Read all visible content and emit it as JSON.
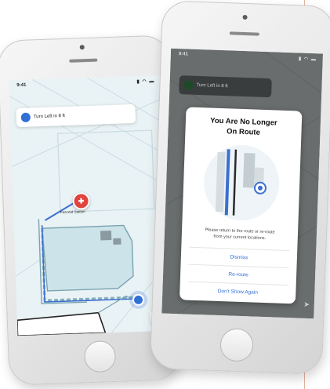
{
  "left_phone": {
    "status": {
      "time": "9:41",
      "icons": "▮ ◠ ▬"
    },
    "nav_card": {
      "text": "Turn Left in 8 ft"
    },
    "poi": {
      "icon": "first-aid-icon",
      "glyph": "✚",
      "label": "First Aid Station"
    },
    "compass_glyph": "➤"
  },
  "right_phone": {
    "status": {
      "time": "9:41",
      "icons": "▮ ◠ ▬"
    },
    "nav_card": {
      "text": "Turn Left in 8 ft"
    },
    "compass_glyph": "➤",
    "modal": {
      "title_line1": "You Are No Longer",
      "title_line2": "On Route",
      "message_line1": "Please return to the route or re-route",
      "message_line2": "from your current locations.",
      "actions": {
        "dismiss": "Dismiss",
        "reroute": "Re-route",
        "dont_show_again": "Don't Show Again"
      }
    }
  },
  "colors": {
    "accent": "#2f6fd6",
    "poi_red": "#e0443d",
    "map_background": "#e9f2f5",
    "route_blue": "#3b6fd0"
  }
}
